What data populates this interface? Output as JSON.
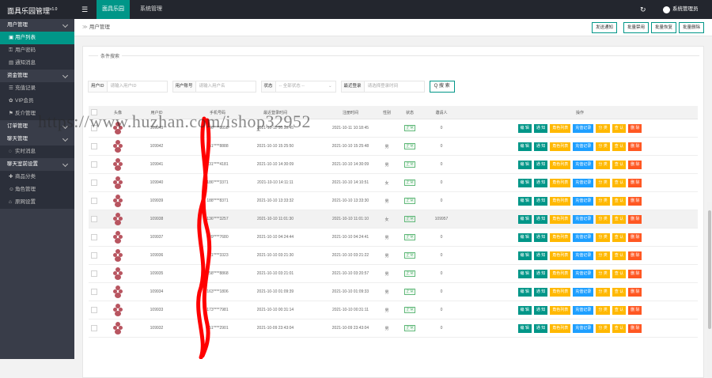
{
  "app": {
    "title": "面具乐园管理",
    "version": "v1.0"
  },
  "topnav": {
    "menu_icon": "☰",
    "tabs": [
      "面具乐园",
      "系统管理"
    ],
    "refresh_icon": "↻",
    "user_name": "系统管理员"
  },
  "sidebar": {
    "items": [
      {
        "label": "用户管理",
        "icon": "",
        "type": "group"
      },
      {
        "label": "用户列表",
        "icon": "▣",
        "type": "active"
      },
      {
        "label": "用户密码",
        "icon": "⚿",
        "type": "sub"
      },
      {
        "label": "通知消息",
        "icon": "▤",
        "type": "sub"
      },
      {
        "label": "资金管理",
        "icon": "",
        "type": "group"
      },
      {
        "label": "充值记录",
        "icon": "☰",
        "type": "sub"
      },
      {
        "label": "VIP会员",
        "icon": "✿",
        "type": "sub"
      },
      {
        "label": "反介管理",
        "icon": "⚑",
        "type": "sub"
      },
      {
        "label": "订单管理",
        "icon": "",
        "type": "group"
      },
      {
        "label": "聊天管理",
        "icon": "",
        "type": "group"
      },
      {
        "label": "实时消息",
        "icon": "◌",
        "type": "sub"
      },
      {
        "label": "聊天室前设置",
        "icon": "",
        "type": "group"
      },
      {
        "label": "商品分类",
        "icon": "✚",
        "type": "sub"
      },
      {
        "label": "角色管理",
        "icon": "☺",
        "type": "sub"
      },
      {
        "label": "原网设置",
        "icon": "⌂",
        "type": "sub"
      }
    ]
  },
  "breadcrumb": {
    "sep": "≫",
    "text": "用户管理"
  },
  "toolbar": {
    "buttons": [
      "发送通知",
      "批量禁用",
      "批量恢复",
      "批量删除"
    ]
  },
  "search": {
    "legend": "条件搜索",
    "fields": [
      {
        "label": "用户ID",
        "placeholder": "请输入用户ID"
      },
      {
        "label": "用户账号",
        "placeholder": "请输入用户名"
      },
      {
        "label": "状态",
        "placeholder": "-- 全部状态 --"
      },
      {
        "label": "最近登录",
        "placeholder": "请选择登录时间"
      }
    ],
    "button": "Q 搜 索"
  },
  "table": {
    "headers": [
      "头像",
      "用户ID",
      "手机号码",
      "最近登录时间",
      "注册时间",
      "性别",
      "状态",
      "邀请人",
      "操作"
    ],
    "action_labels": [
      "编 辑",
      "通 知",
      "角色列表",
      "充值记录",
      "分 类",
      "查 认",
      "删 除"
    ],
    "rows": [
      {
        "id": "109943",
        "phone": "136****8858",
        "login": "2021-10-11 10:18:45",
        "reg": "2021-10-11 10:18:45",
        "gender": "",
        "status": "正常",
        "inviter": "0"
      },
      {
        "id": "109942",
        "phone": "151****8888",
        "login": "2021-10-10 15:25:50",
        "reg": "2021-10-10 15:25:48",
        "gender": "男",
        "status": "正常",
        "inviter": "0"
      },
      {
        "id": "109941",
        "phone": "131****4181",
        "login": "2021-10-10 14:30:09",
        "reg": "2021-10-10 14:30:09",
        "gender": "男",
        "status": "正常",
        "inviter": "0"
      },
      {
        "id": "109940",
        "phone": "186****3371",
        "login": "2021-10-10 14:11:11",
        "reg": "2021-10-10 14:10:51",
        "gender": "女",
        "status": "正常",
        "inviter": "0"
      },
      {
        "id": "109939",
        "phone": "188****8371",
        "login": "2021-10-10 13:33:32",
        "reg": "2021-10-10 13:33:30",
        "gender": "男",
        "status": "正常",
        "inviter": "0"
      },
      {
        "id": "109938",
        "phone": "136****3257",
        "login": "2021-10-10 11:01:30",
        "reg": "2021-10-10 11:01:10",
        "gender": "女",
        "status": "正常",
        "inviter": "109957"
      },
      {
        "id": "109937",
        "phone": "189****7680",
        "login": "2021-10-10 04:24:44",
        "reg": "2021-10-10 04:24:41",
        "gender": "男",
        "status": "正常",
        "inviter": "0"
      },
      {
        "id": "109936",
        "phone": "151****3323",
        "login": "2021-10-10 03:21:30",
        "reg": "2021-10-10 03:21:22",
        "gender": "男",
        "status": "正常",
        "inviter": "0"
      },
      {
        "id": "109935",
        "phone": "158****8868",
        "login": "2021-10-10 03:21:01",
        "reg": "2021-10-10 03:20:57",
        "gender": "男",
        "status": "正常",
        "inviter": "0"
      },
      {
        "id": "109934",
        "phone": "163****1806",
        "login": "2021-10-10 01:09:39",
        "reg": "2021-10-10 01:09:33",
        "gender": "男",
        "status": "正常",
        "inviter": "0"
      },
      {
        "id": "109933",
        "phone": "173****7981",
        "login": "2021-10-10 00:31:14",
        "reg": "2021-10-10 00:31:11",
        "gender": "男",
        "status": "正常",
        "inviter": "0"
      },
      {
        "id": "109932",
        "phone": "151****2901",
        "login": "2021-10-09 23:43:04",
        "reg": "2021-10-09 23:43:04",
        "gender": "男",
        "status": "正常",
        "inviter": "0"
      }
    ]
  },
  "watermark": "https://www.huzhan.com/ishop32952",
  "colors": {
    "topbar": "#23262e",
    "sidebar": "#393d49",
    "accent": "#009688",
    "orange": "#ffb800",
    "blue": "#1e9fff",
    "red": "#ff5722",
    "status_green": "#5fb878",
    "scribble": "#ff0000"
  }
}
